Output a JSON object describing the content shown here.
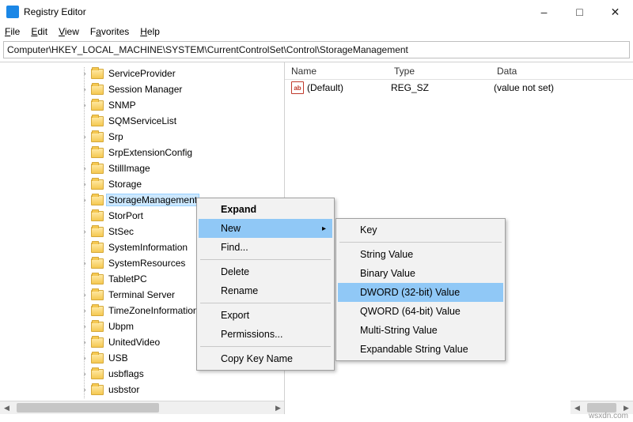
{
  "window": {
    "title": "Registry Editor"
  },
  "menubar": {
    "file": "File",
    "edit": "Edit",
    "view": "View",
    "favorites": "Favorites",
    "help": "Help"
  },
  "address": "Computer\\HKEY_LOCAL_MACHINE\\SYSTEM\\CurrentControlSet\\Control\\StorageManagement",
  "tree": [
    {
      "label": "ServiceProvider",
      "exp": ">"
    },
    {
      "label": "Session Manager",
      "exp": ">"
    },
    {
      "label": "SNMP",
      "exp": ">"
    },
    {
      "label": "SQMServiceList",
      "exp": ""
    },
    {
      "label": "Srp",
      "exp": ">"
    },
    {
      "label": "SrpExtensionConfig",
      "exp": ""
    },
    {
      "label": "StillImage",
      "exp": ">"
    },
    {
      "label": "Storage",
      "exp": ">"
    },
    {
      "label": "StorageManagement",
      "exp": ">",
      "selected": true
    },
    {
      "label": "StorPort",
      "exp": ""
    },
    {
      "label": "StSec",
      "exp": ">"
    },
    {
      "label": "SystemInformation",
      "exp": ""
    },
    {
      "label": "SystemResources",
      "exp": ">"
    },
    {
      "label": "TabletPC",
      "exp": ""
    },
    {
      "label": "Terminal Server",
      "exp": ">"
    },
    {
      "label": "TimeZoneInformation",
      "exp": ">"
    },
    {
      "label": "Ubpm",
      "exp": ">"
    },
    {
      "label": "UnitedVideo",
      "exp": ">"
    },
    {
      "label": "USB",
      "exp": ">"
    },
    {
      "label": "usbflags",
      "exp": ">"
    },
    {
      "label": "usbstor",
      "exp": ">"
    }
  ],
  "list": {
    "headers": {
      "name": "Name",
      "type": "Type",
      "data": "Data"
    },
    "rows": [
      {
        "icon": "ab",
        "name": "(Default)",
        "type": "REG_SZ",
        "data": "(value not set)"
      }
    ]
  },
  "ctx1": {
    "expand": "Expand",
    "new": "New",
    "find": "Find...",
    "delete": "Delete",
    "rename": "Rename",
    "export": "Export",
    "permissions": "Permissions...",
    "copykey": "Copy Key Name"
  },
  "ctx2": {
    "key": "Key",
    "string": "String Value",
    "binary": "Binary Value",
    "dword": "DWORD (32-bit) Value",
    "qword": "QWORD (64-bit) Value",
    "multistring": "Multi-String Value",
    "expstring": "Expandable String Value"
  },
  "watermark": "wsxdn.com"
}
